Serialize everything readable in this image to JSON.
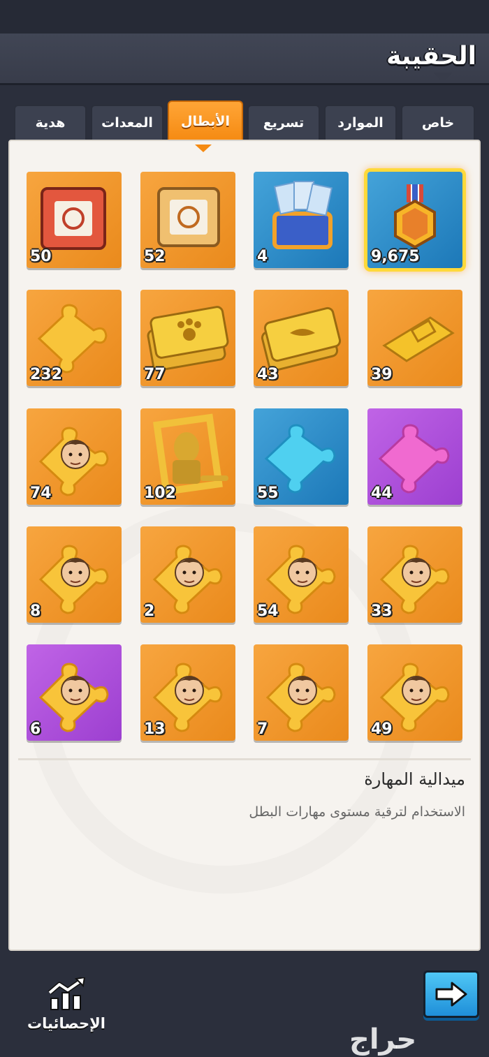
{
  "header": {
    "title": "الحقيبة"
  },
  "tabs": [
    {
      "label": "خاص"
    },
    {
      "label": "الموارد"
    },
    {
      "label": "تسريع"
    },
    {
      "label": "الأبطال"
    },
    {
      "label": "المعدات"
    },
    {
      "label": "هدية"
    }
  ],
  "active_tab": "الأبطال",
  "items": [
    {
      "count": "9,675",
      "icon": "skill-medal-icon",
      "bg": "blue",
      "selected": true
    },
    {
      "count": "4",
      "icon": "exp-cards-chest-icon",
      "bg": "blue"
    },
    {
      "count": "52",
      "icon": "gold-hero-chest-icon",
      "bg": "orange"
    },
    {
      "count": "50",
      "icon": "red-hero-chest-icon",
      "bg": "orange"
    },
    {
      "count": "39",
      "icon": "gold-ticket-icon",
      "bg": "orange"
    },
    {
      "count": "43",
      "icon": "eagle-gold-ticket-icon",
      "bg": "orange"
    },
    {
      "count": "77",
      "icon": "paw-gold-ticket-icon",
      "bg": "orange"
    },
    {
      "count": "232",
      "icon": "gold-puzzle-piece-icon",
      "bg": "orange"
    },
    {
      "count": "44",
      "icon": "purple-puzzle-piece-icon",
      "bg": "purple"
    },
    {
      "count": "55",
      "icon": "blue-puzzle-piece-icon",
      "bg": "blue"
    },
    {
      "count": "102",
      "icon": "gold-statue-frame-icon",
      "bg": "orange"
    },
    {
      "count": "74",
      "icon": "hero-shard-icon",
      "bg": "orange"
    },
    {
      "count": "33",
      "icon": "hero-shard-icon",
      "bg": "orange"
    },
    {
      "count": "54",
      "icon": "hero-shard-icon",
      "bg": "orange"
    },
    {
      "count": "2",
      "icon": "hero-shard-icon",
      "bg": "orange"
    },
    {
      "count": "8",
      "icon": "hero-shard-icon",
      "bg": "orange"
    },
    {
      "count": "49",
      "icon": "hero-shard-icon",
      "bg": "orange"
    },
    {
      "count": "7",
      "icon": "hero-shard-icon",
      "bg": "orange"
    },
    {
      "count": "13",
      "icon": "hero-shard-icon",
      "bg": "orange"
    },
    {
      "count": "6",
      "icon": "hero-shard-icon",
      "bg": "purple"
    }
  ],
  "description": {
    "title": "ميدالية المهارة",
    "text": "الاستخدام لترقية مستوى مهارات البطل"
  },
  "footer": {
    "stats_label": "الإحصائيات",
    "next_icon": "arrow-right-icon",
    "brand": "حراج"
  },
  "colors": {
    "accent": "#f58a12",
    "panel": "#f6f3ef",
    "background": "#2b2f3c",
    "tile_orange": "#f0962c",
    "tile_blue": "#2b8ccb",
    "tile_purple": "#ac4fdb"
  }
}
